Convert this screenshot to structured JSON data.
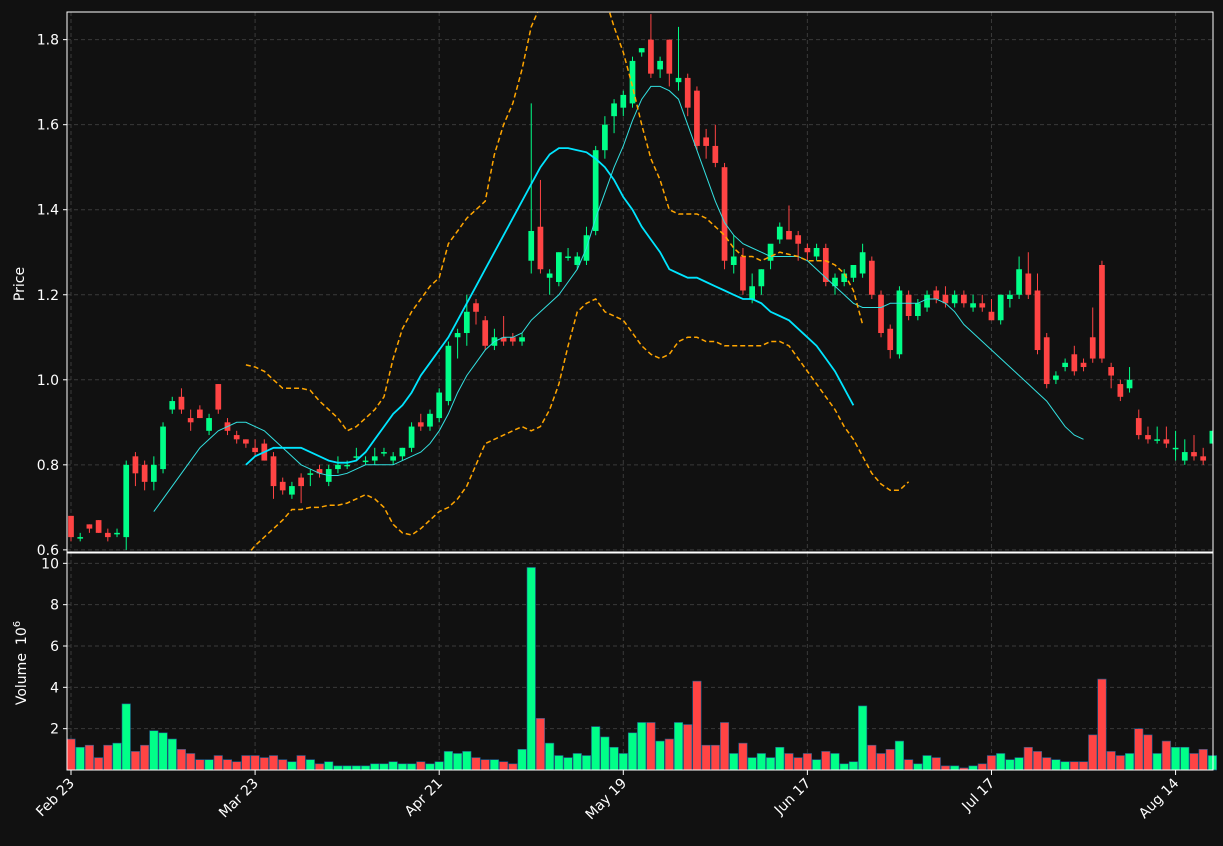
{
  "chart_data": {
    "type": "candlestick",
    "colors": {
      "background": "#111111",
      "up": "#00ff88",
      "down": "#ff4444",
      "ma_fast": "#33e0e0",
      "ma_slow": "#00e5ff",
      "bands": "#ffa500",
      "grid": "#3a3a3a",
      "axis_text": "#ffffff"
    },
    "price_ylabel": "Price",
    "volume_ylabel": "Volume",
    "volume_exponent_label": "10",
    "volume_exponent": "6",
    "price_ylim": [
      0.595,
      1.865
    ],
    "volume_ylim": [
      0,
      10.5
    ],
    "price_yticks": [
      "0.6",
      "0.8",
      "1.0",
      "1.2",
      "1.4",
      "1.6",
      "1.8"
    ],
    "volume_yticks": [
      "2",
      "4",
      "6",
      "8",
      "10"
    ],
    "x_ticks": [
      {
        "label": "Feb 23",
        "index": 0
      },
      {
        "label": "Mar 23",
        "index": 20
      },
      {
        "label": "Apr 21",
        "index": 40
      },
      {
        "label": "May 19",
        "index": 60
      },
      {
        "label": "Jun 17",
        "index": 80
      },
      {
        "label": "Jul 17",
        "index": 100
      },
      {
        "label": "Aug 14",
        "index": 120
      }
    ],
    "bars": [
      [
        0.68,
        0.68,
        0.62,
        0.63,
        1.5
      ],
      [
        0.63,
        0.64,
        0.62,
        0.63,
        1.1
      ],
      [
        0.66,
        0.66,
        0.64,
        0.65,
        1.2
      ],
      [
        0.67,
        0.67,
        0.64,
        0.64,
        0.6
      ],
      [
        0.64,
        0.65,
        0.62,
        0.63,
        1.2
      ],
      [
        0.64,
        0.65,
        0.63,
        0.64,
        1.3
      ],
      [
        0.63,
        0.81,
        0.6,
        0.8,
        3.2
      ],
      [
        0.82,
        0.83,
        0.75,
        0.78,
        0.9
      ],
      [
        0.8,
        0.81,
        0.74,
        0.76,
        1.2
      ],
      [
        0.76,
        0.82,
        0.74,
        0.8,
        1.9
      ],
      [
        0.79,
        0.9,
        0.78,
        0.89,
        1.8
      ],
      [
        0.93,
        0.96,
        0.92,
        0.95,
        1.5
      ],
      [
        0.96,
        0.98,
        0.92,
        0.93,
        1.0
      ],
      [
        0.91,
        0.93,
        0.88,
        0.9,
        0.8
      ],
      [
        0.93,
        0.94,
        0.91,
        0.91,
        0.5
      ],
      [
        0.88,
        0.92,
        0.87,
        0.91,
        0.5
      ],
      [
        0.99,
        0.99,
        0.92,
        0.93,
        0.7
      ],
      [
        0.9,
        0.91,
        0.87,
        0.88,
        0.5
      ],
      [
        0.87,
        0.88,
        0.85,
        0.86,
        0.4
      ],
      [
        0.86,
        0.86,
        0.84,
        0.85,
        0.7
      ],
      [
        0.84,
        0.86,
        0.82,
        0.83,
        0.7
      ],
      [
        0.85,
        0.86,
        0.81,
        0.81,
        0.6
      ],
      [
        0.82,
        0.83,
        0.72,
        0.75,
        0.7
      ],
      [
        0.76,
        0.77,
        0.73,
        0.74,
        0.5
      ],
      [
        0.73,
        0.76,
        0.72,
        0.75,
        0.4
      ],
      [
        0.77,
        0.78,
        0.71,
        0.75,
        0.7
      ],
      [
        0.78,
        0.79,
        0.75,
        0.78,
        0.5
      ],
      [
        0.79,
        0.8,
        0.77,
        0.78,
        0.3
      ],
      [
        0.76,
        0.8,
        0.75,
        0.79,
        0.4
      ],
      [
        0.79,
        0.82,
        0.78,
        0.8,
        0.2
      ],
      [
        0.8,
        0.81,
        0.79,
        0.8,
        0.2
      ],
      [
        0.82,
        0.84,
        0.81,
        0.82,
        0.2
      ],
      [
        0.81,
        0.82,
        0.8,
        0.81,
        0.2
      ],
      [
        0.81,
        0.84,
        0.8,
        0.82,
        0.3
      ],
      [
        0.83,
        0.84,
        0.82,
        0.83,
        0.3
      ],
      [
        0.81,
        0.83,
        0.8,
        0.82,
        0.4
      ],
      [
        0.82,
        0.84,
        0.81,
        0.84,
        0.3
      ],
      [
        0.84,
        0.9,
        0.83,
        0.89,
        0.3
      ],
      [
        0.9,
        0.92,
        0.88,
        0.89,
        0.4
      ],
      [
        0.89,
        0.93,
        0.88,
        0.92,
        0.3
      ],
      [
        0.91,
        0.98,
        0.9,
        0.97,
        0.4
      ],
      [
        0.95,
        1.09,
        0.94,
        1.08,
        0.9
      ],
      [
        1.1,
        1.12,
        1.05,
        1.11,
        0.8
      ],
      [
        1.11,
        1.2,
        1.08,
        1.16,
        0.9
      ],
      [
        1.18,
        1.19,
        1.13,
        1.16,
        0.6
      ],
      [
        1.14,
        1.15,
        1.07,
        1.08,
        0.5
      ],
      [
        1.08,
        1.12,
        1.07,
        1.1,
        0.5
      ],
      [
        1.1,
        1.15,
        1.08,
        1.09,
        0.4
      ],
      [
        1.1,
        1.11,
        1.08,
        1.09,
        0.3
      ],
      [
        1.09,
        1.11,
        1.08,
        1.1,
        1.0
      ],
      [
        1.28,
        1.65,
        1.25,
        1.35,
        9.8
      ],
      [
        1.36,
        1.47,
        1.25,
        1.26,
        2.5
      ],
      [
        1.24,
        1.26,
        1.2,
        1.25,
        1.3
      ],
      [
        1.23,
        1.3,
        1.22,
        1.3,
        0.7
      ],
      [
        1.29,
        1.31,
        1.28,
        1.29,
        0.6
      ],
      [
        1.27,
        1.3,
        1.26,
        1.29,
        0.8
      ],
      [
        1.28,
        1.36,
        1.27,
        1.34,
        0.7
      ],
      [
        1.35,
        1.55,
        1.34,
        1.54,
        2.1
      ],
      [
        1.54,
        1.62,
        1.52,
        1.6,
        1.6
      ],
      [
        1.62,
        1.66,
        1.58,
        1.65,
        1.1
      ],
      [
        1.64,
        1.68,
        1.62,
        1.67,
        0.8
      ],
      [
        1.65,
        1.76,
        1.64,
        1.75,
        1.8
      ],
      [
        1.77,
        1.78,
        1.76,
        1.78,
        2.3
      ],
      [
        1.8,
        1.86,
        1.71,
        1.72,
        2.3
      ],
      [
        1.73,
        1.76,
        1.71,
        1.75,
        1.4
      ],
      [
        1.8,
        1.8,
        1.69,
        1.72,
        1.5
      ],
      [
        1.7,
        1.83,
        1.68,
        1.71,
        2.3
      ],
      [
        1.71,
        1.72,
        1.62,
        1.64,
        2.2
      ],
      [
        1.68,
        1.69,
        1.54,
        1.55,
        4.3
      ],
      [
        1.57,
        1.59,
        1.52,
        1.55,
        1.2
      ],
      [
        1.55,
        1.6,
        1.5,
        1.51,
        1.2
      ],
      [
        1.5,
        1.51,
        1.26,
        1.28,
        2.3
      ],
      [
        1.27,
        1.34,
        1.25,
        1.29,
        0.8
      ],
      [
        1.29,
        1.31,
        1.2,
        1.21,
        1.3
      ],
      [
        1.19,
        1.25,
        1.18,
        1.22,
        0.6
      ],
      [
        1.22,
        1.26,
        1.2,
        1.26,
        0.8
      ],
      [
        1.28,
        1.31,
        1.26,
        1.32,
        0.6
      ],
      [
        1.33,
        1.37,
        1.32,
        1.36,
        1.1
      ],
      [
        1.35,
        1.41,
        1.33,
        1.33,
        0.8
      ],
      [
        1.34,
        1.35,
        1.28,
        1.32,
        0.6
      ],
      [
        1.31,
        1.32,
        1.28,
        1.3,
        0.8
      ],
      [
        1.29,
        1.32,
        1.28,
        1.31,
        0.5
      ],
      [
        1.31,
        1.32,
        1.22,
        1.23,
        0.9
      ],
      [
        1.22,
        1.25,
        1.2,
        1.24,
        0.8
      ],
      [
        1.23,
        1.26,
        1.22,
        1.25,
        0.3
      ],
      [
        1.24,
        1.27,
        1.23,
        1.27,
        0.4
      ],
      [
        1.25,
        1.32,
        1.24,
        1.3,
        3.1
      ],
      [
        1.28,
        1.29,
        1.19,
        1.2,
        1.2
      ],
      [
        1.2,
        1.21,
        1.1,
        1.11,
        0.8
      ],
      [
        1.12,
        1.13,
        1.05,
        1.07,
        1.0
      ],
      [
        1.06,
        1.22,
        1.05,
        1.21,
        1.4
      ],
      [
        1.2,
        1.21,
        1.14,
        1.15,
        0.5
      ],
      [
        1.15,
        1.19,
        1.14,
        1.18,
        0.3
      ],
      [
        1.17,
        1.21,
        1.16,
        1.2,
        0.7
      ],
      [
        1.21,
        1.22,
        1.18,
        1.19,
        0.6
      ],
      [
        1.2,
        1.22,
        1.17,
        1.18,
        0.2
      ],
      [
        1.18,
        1.21,
        1.17,
        1.2,
        0.2
      ],
      [
        1.2,
        1.21,
        1.17,
        1.18,
        0.1
      ],
      [
        1.17,
        1.2,
        1.16,
        1.18,
        0.2
      ],
      [
        1.18,
        1.2,
        1.16,
        1.17,
        0.3
      ],
      [
        1.16,
        1.19,
        1.14,
        1.14,
        0.7
      ],
      [
        1.14,
        1.2,
        1.13,
        1.2,
        0.8
      ],
      [
        1.19,
        1.21,
        1.17,
        1.2,
        0.5
      ],
      [
        1.2,
        1.29,
        1.19,
        1.26,
        0.6
      ],
      [
        1.25,
        1.3,
        1.19,
        1.2,
        1.1
      ],
      [
        1.21,
        1.25,
        1.06,
        1.07,
        0.9
      ],
      [
        1.1,
        1.11,
        0.98,
        0.99,
        0.6
      ],
      [
        1.0,
        1.02,
        0.99,
        1.01,
        0.5
      ],
      [
        1.03,
        1.05,
        1.02,
        1.04,
        0.4
      ],
      [
        1.06,
        1.08,
        1.01,
        1.02,
        0.4
      ],
      [
        1.04,
        1.05,
        1.02,
        1.03,
        0.4
      ],
      [
        1.1,
        1.17,
        1.04,
        1.05,
        1.7
      ],
      [
        1.27,
        1.28,
        1.04,
        1.05,
        4.4
      ],
      [
        1.03,
        1.04,
        0.98,
        1.01,
        0.9
      ],
      [
        0.99,
        1.0,
        0.95,
        0.96,
        0.7
      ],
      [
        0.98,
        1.03,
        0.97,
        1.0,
        0.8
      ],
      [
        0.91,
        0.93,
        0.86,
        0.87,
        2.0
      ],
      [
        0.87,
        0.89,
        0.85,
        0.86,
        1.7
      ],
      [
        0.86,
        0.89,
        0.85,
        0.86,
        0.8
      ],
      [
        0.86,
        0.89,
        0.84,
        0.85,
        1.4
      ],
      [
        0.84,
        0.88,
        0.81,
        0.84,
        1.1
      ],
      [
        0.81,
        0.86,
        0.8,
        0.83,
        1.1
      ],
      [
        0.83,
        0.87,
        0.81,
        0.82,
        0.8
      ],
      [
        0.82,
        0.84,
        0.8,
        0.81,
        1.0
      ],
      [
        0.85,
        0.88,
        0.85,
        0.88,
        0.7
      ]
    ],
    "ma_fast": [
      null,
      null,
      null,
      null,
      null,
      null,
      null,
      null,
      null,
      0.69,
      0.72,
      0.75,
      0.78,
      0.81,
      0.84,
      0.86,
      0.88,
      0.89,
      0.9,
      0.9,
      0.89,
      0.88,
      0.86,
      0.84,
      0.82,
      0.8,
      0.79,
      0.78,
      0.775,
      0.775,
      0.78,
      0.79,
      0.8,
      0.8,
      0.8,
      0.8,
      0.81,
      0.82,
      0.83,
      0.85,
      0.88,
      0.92,
      0.97,
      1.01,
      1.04,
      1.07,
      1.09,
      1.1,
      1.1,
      1.11,
      1.14,
      1.16,
      1.18,
      1.2,
      1.23,
      1.26,
      1.31,
      1.38,
      1.44,
      1.5,
      1.55,
      1.61,
      1.66,
      1.69,
      1.69,
      1.68,
      1.66,
      1.6,
      1.54,
      1.48,
      1.42,
      1.37,
      1.34,
      1.32,
      1.31,
      1.3,
      1.29,
      1.29,
      1.29,
      1.29,
      1.28,
      1.26,
      1.24,
      1.22,
      1.2,
      1.18,
      1.17,
      1.17,
      1.17,
      1.18,
      1.18,
      1.18,
      1.18,
      1.19,
      1.19,
      1.18,
      1.16,
      1.13,
      1.11,
      1.09,
      1.07,
      1.05,
      1.03,
      1.01,
      0.99,
      0.97,
      0.95,
      0.92,
      0.89,
      0.87,
      0.86
    ],
    "ma_slow": [
      null,
      null,
      null,
      null,
      null,
      null,
      null,
      null,
      null,
      null,
      null,
      null,
      null,
      null,
      null,
      null,
      null,
      null,
      null,
      0.8,
      0.82,
      0.83,
      0.84,
      0.84,
      0.84,
      0.84,
      0.83,
      0.82,
      0.81,
      0.805,
      0.805,
      0.81,
      0.83,
      0.86,
      0.89,
      0.92,
      0.94,
      0.97,
      1.01,
      1.04,
      1.07,
      1.1,
      1.14,
      1.18,
      1.22,
      1.26,
      1.3,
      1.34,
      1.38,
      1.42,
      1.46,
      1.5,
      1.53,
      1.545,
      1.545,
      1.54,
      1.535,
      1.52,
      1.5,
      1.47,
      1.43,
      1.4,
      1.36,
      1.33,
      1.3,
      1.26,
      1.25,
      1.24,
      1.24,
      1.23,
      1.22,
      1.21,
      1.2,
      1.19,
      1.19,
      1.18,
      1.16,
      1.15,
      1.14,
      1.12,
      1.1,
      1.08,
      1.05,
      1.02,
      0.98,
      0.94
    ],
    "bb_upper": [
      null,
      null,
      null,
      null,
      null,
      null,
      null,
      null,
      null,
      null,
      null,
      null,
      null,
      null,
      null,
      null,
      null,
      null,
      null,
      1.035,
      1.03,
      1.02,
      1.0,
      0.98,
      0.98,
      0.98,
      0.975,
      0.95,
      0.93,
      0.91,
      0.88,
      0.89,
      0.91,
      0.93,
      0.96,
      1.05,
      1.12,
      1.16,
      1.19,
      1.22,
      1.24,
      1.32,
      1.35,
      1.38,
      1.4,
      1.42,
      1.53,
      1.6,
      1.65,
      1.73,
      1.83,
      1.88,
      1.94,
      1.99,
      2.02,
      2.05,
      2.02,
      1.97,
      1.9,
      1.83,
      1.77,
      1.69,
      1.6,
      1.52,
      1.47,
      1.4,
      1.39,
      1.39,
      1.39,
      1.38,
      1.36,
      1.34,
      1.31,
      1.29,
      1.29,
      1.28,
      1.29,
      1.3,
      1.295,
      1.29,
      1.28,
      1.28,
      1.28,
      1.27,
      1.25,
      1.21,
      1.13
    ],
    "bb_lower": [
      null,
      null,
      null,
      null,
      null,
      null,
      null,
      null,
      null,
      null,
      null,
      null,
      null,
      null,
      null,
      null,
      null,
      null,
      null,
      0.585,
      0.61,
      0.63,
      0.65,
      0.67,
      0.695,
      0.695,
      0.7,
      0.7,
      0.705,
      0.705,
      0.71,
      0.72,
      0.73,
      0.72,
      0.7,
      0.66,
      0.64,
      0.635,
      0.65,
      0.67,
      0.69,
      0.7,
      0.72,
      0.75,
      0.8,
      0.85,
      0.86,
      0.87,
      0.88,
      0.89,
      0.88,
      0.89,
      0.93,
      0.99,
      1.08,
      1.16,
      1.18,
      1.19,
      1.16,
      1.15,
      1.14,
      1.11,
      1.08,
      1.06,
      1.05,
      1.06,
      1.09,
      1.1,
      1.1,
      1.09,
      1.09,
      1.08,
      1.08,
      1.08,
      1.08,
      1.08,
      1.09,
      1.09,
      1.08,
      1.05,
      1.02,
      0.99,
      0.96,
      0.93,
      0.89,
      0.86,
      0.82,
      0.78,
      0.755,
      0.74,
      0.74,
      0.76
    ]
  }
}
